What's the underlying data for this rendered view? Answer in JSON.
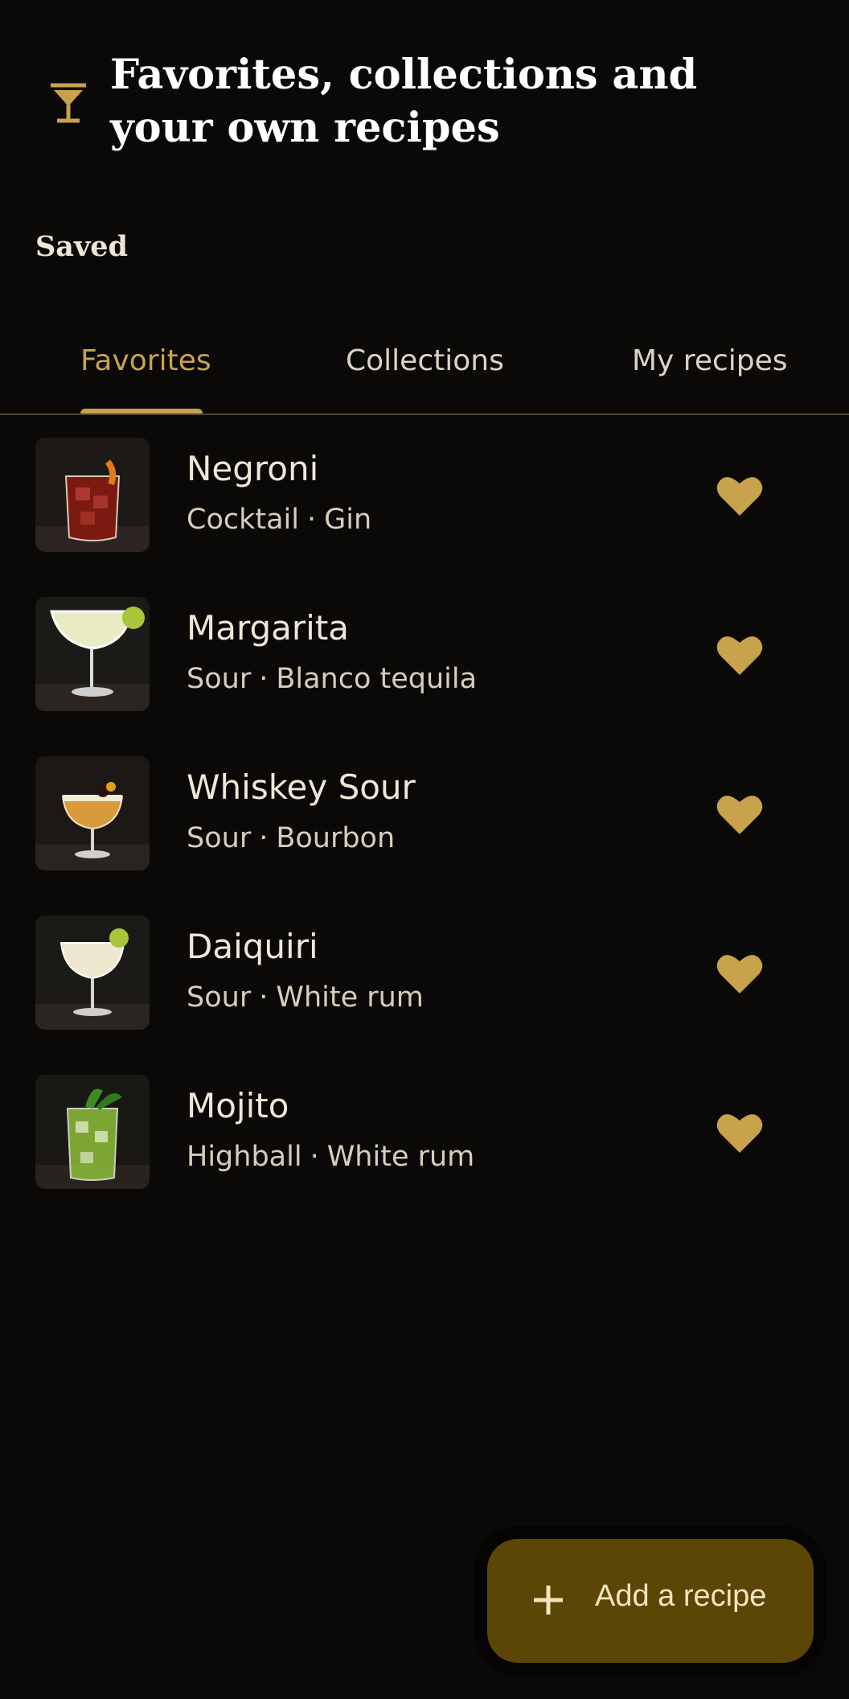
{
  "header": {
    "title_line1": "Favorites, collections and",
    "title_line2": "your own recipes",
    "icon": "cocktail-glass-icon"
  },
  "section": {
    "label": "Saved"
  },
  "tabs": [
    {
      "label": "Favorites",
      "active": true
    },
    {
      "label": "Collections",
      "active": false
    },
    {
      "label": "My recipes",
      "active": false
    }
  ],
  "recipes": [
    {
      "name": "Negroni",
      "category": "Cocktail",
      "spirit": "Gin",
      "favorite": true
    },
    {
      "name": "Margarita",
      "category": "Sour",
      "spirit": "Blanco tequila",
      "favorite": true
    },
    {
      "name": "Whiskey Sour",
      "category": "Sour",
      "spirit": "Bourbon",
      "favorite": true
    },
    {
      "name": "Daiquiri",
      "category": "Sour",
      "spirit": "White rum",
      "favorite": true
    },
    {
      "name": "Mojito",
      "category": "Highball",
      "spirit": "White rum",
      "favorite": true
    }
  ],
  "fab": {
    "label": "Add a recipe",
    "icon": "plus-icon"
  },
  "colors": {
    "background": "#0a0908",
    "accent": "#c9a24c",
    "fab_background": "#5b4606"
  }
}
